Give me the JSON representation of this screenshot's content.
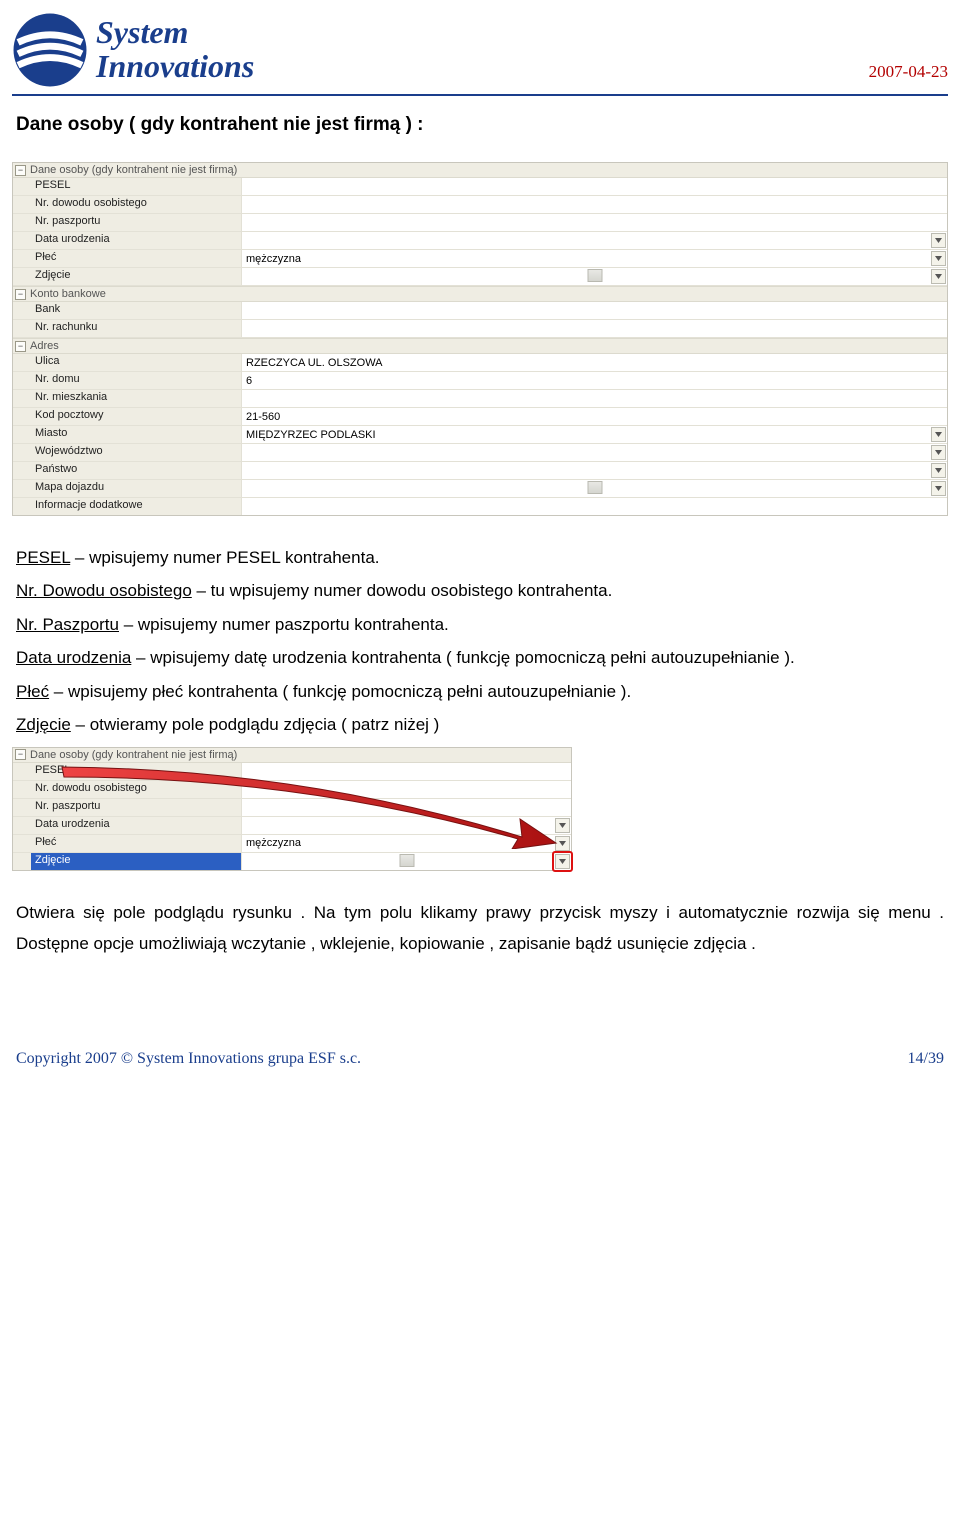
{
  "header": {
    "logo_line1": "System",
    "logo_line2": "Innovations",
    "date": "2007-04-23"
  },
  "section_title": "Dane osoby ( gdy kontrahent nie jest firmą ) :",
  "panel1": {
    "groups": [
      {
        "title": "Dane osoby (gdy kontrahent nie jest firmą)",
        "rows": [
          {
            "label": "PESEL",
            "value": "",
            "dropdown": false
          },
          {
            "label": "Nr. dowodu osobistego",
            "value": "",
            "dropdown": false
          },
          {
            "label": "Nr. paszportu",
            "value": "",
            "dropdown": false
          },
          {
            "label": "Data urodzenia",
            "value": "",
            "dropdown": true
          },
          {
            "label": "Płeć",
            "value": "mężczyzna",
            "dropdown": true
          },
          {
            "label": "Zdjęcie",
            "value": "",
            "dropdown": true,
            "image": true
          }
        ]
      },
      {
        "title": "Konto bankowe",
        "rows": [
          {
            "label": "Bank",
            "value": "",
            "dropdown": false
          },
          {
            "label": "Nr. rachunku",
            "value": "",
            "dropdown": false
          }
        ]
      },
      {
        "title": "Adres",
        "rows": [
          {
            "label": "Ulica",
            "value": "RZECZYCA UL. OLSZOWA",
            "dropdown": false
          },
          {
            "label": "Nr. domu",
            "value": "6",
            "dropdown": false
          },
          {
            "label": "Nr. mieszkania",
            "value": "",
            "dropdown": false
          },
          {
            "label": "Kod pocztowy",
            "value": "21-560",
            "dropdown": false
          },
          {
            "label": "Miasto",
            "value": "MIĘDZYRZEC PODLASKI",
            "dropdown": true
          },
          {
            "label": "Województwo",
            "value": "",
            "dropdown": true
          },
          {
            "label": "Państwo",
            "value": "",
            "dropdown": true
          },
          {
            "label": "Mapa dojazdu",
            "value": "",
            "dropdown": true,
            "image": true
          },
          {
            "label": "Informacje dodatkowe",
            "value": "",
            "dropdown": false
          }
        ]
      }
    ]
  },
  "text1": {
    "lines": [
      {
        "u": "PESEL",
        "rest": " – wpisujemy numer PESEL kontrahenta."
      },
      {
        "u": "Nr. Dowodu osobistego",
        "rest": " – tu wpisujemy numer dowodu osobistego kontrahenta."
      },
      {
        "u": "Nr. Paszportu",
        "rest": " – wpisujemy numer paszportu kontrahenta."
      },
      {
        "u": "Data urodzenia",
        "rest": " – wpisujemy datę urodzenia kontrahenta ( funkcję pomocniczą pełni autouzupełnianie )."
      },
      {
        "u": "Płeć",
        "rest": " – wpisujemy płeć kontrahenta ( funkcję pomocniczą pełni autouzupełnianie )."
      },
      {
        "u": "Zdjęcie",
        "rest": " – otwieramy pole podglądu zdjęcia ( patrz niżej )"
      }
    ]
  },
  "panel2": {
    "group_title": "Dane osoby (gdy kontrahent nie jest firmą)",
    "rows": [
      {
        "label": "PESEL",
        "value": "",
        "dropdown": false
      },
      {
        "label": "Nr. dowodu osobistego",
        "value": "",
        "dropdown": false
      },
      {
        "label": "Nr. paszportu",
        "value": "",
        "dropdown": false
      },
      {
        "label": "Data urodzenia",
        "value": "",
        "dropdown": true
      },
      {
        "label": "Płeć",
        "value": "mężczyzna",
        "dropdown": true
      },
      {
        "label": "Zdjęcie",
        "value": "",
        "dropdown": true,
        "image": true,
        "selected": true,
        "highlight": true
      }
    ]
  },
  "text2": "Otwiera się pole podglądu rysunku . Na tym polu klikamy prawy przycisk myszy i automatycznie rozwija się menu . Dostępne opcje umożliwiają wczytanie , wklejenie, kopiowanie , zapisanie bądź usunięcie zdjęcia .",
  "footer": {
    "copyright": "Copyright 2007 © System Innovations grupa ESF s.c.",
    "page": "14/39"
  },
  "icons": {
    "collapse": "−"
  }
}
